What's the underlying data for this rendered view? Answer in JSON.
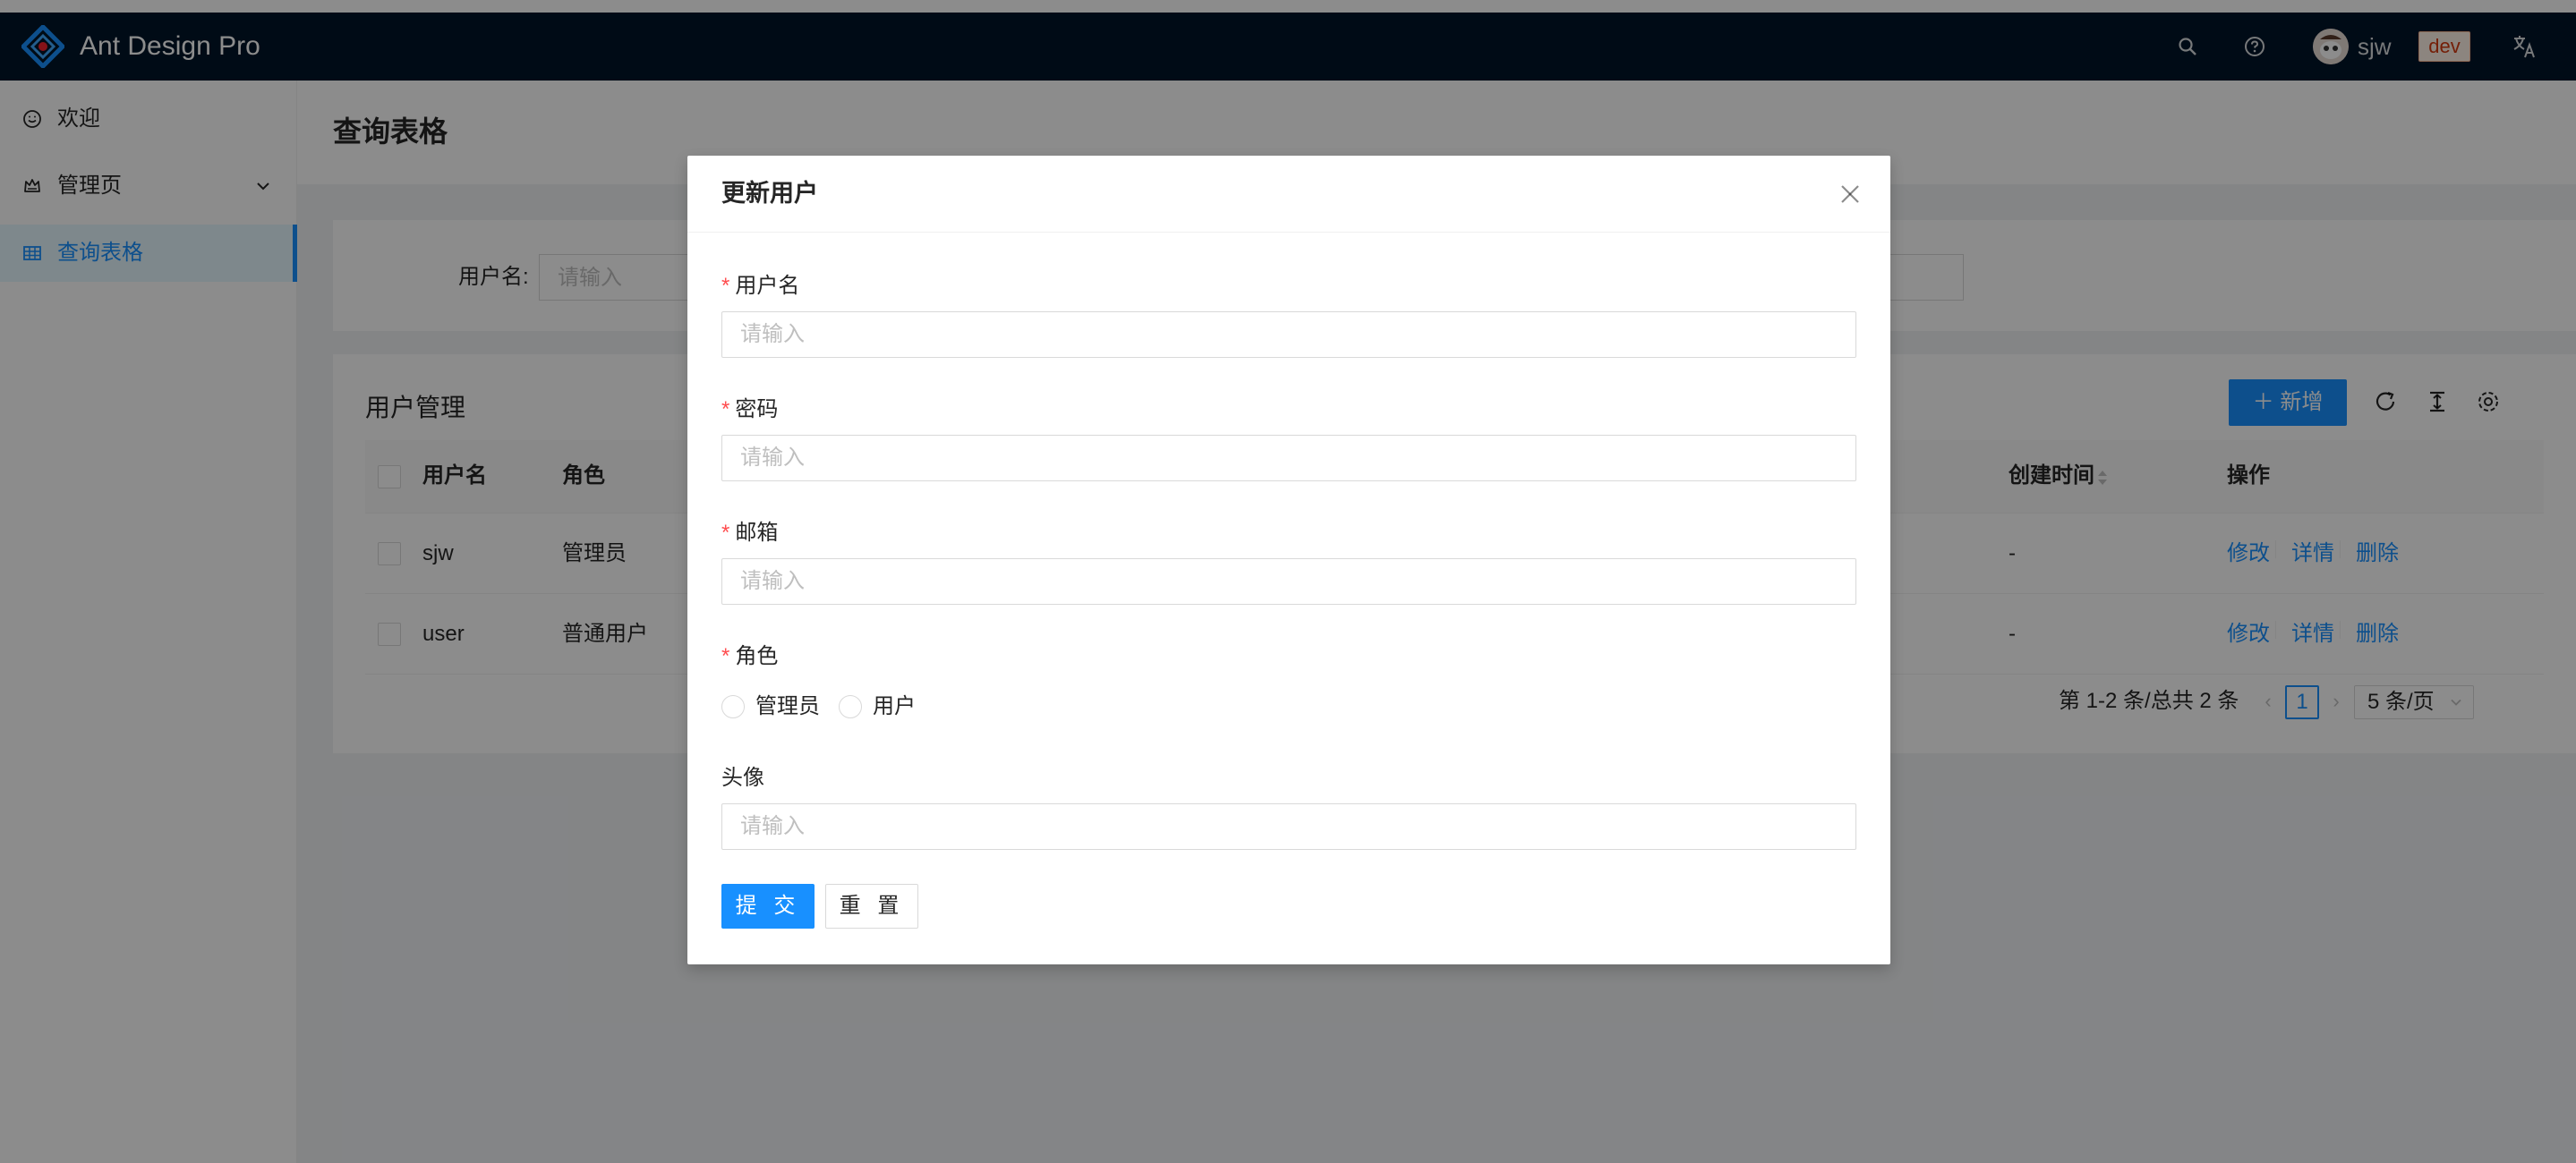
{
  "app": {
    "title": "Ant Design Pro"
  },
  "header": {
    "user_name": "sjw",
    "env_tag": "dev",
    "icons": [
      "search-icon",
      "question-icon",
      "translate-icon"
    ]
  },
  "sidebar": {
    "items": [
      {
        "label": "欢迎",
        "icon": "smile-icon"
      },
      {
        "label": "管理页",
        "icon": "crown-icon"
      },
      {
        "label": "查询表格",
        "icon": "table-icon",
        "selected": true
      }
    ]
  },
  "page": {
    "title": "查询表格",
    "search": {
      "label": "用户名:",
      "placeholder": "请输入"
    }
  },
  "table": {
    "title": "用户管理",
    "new_button": "新增",
    "columns": [
      "用户名",
      "角色",
      "创建时间",
      "操作"
    ],
    "rows": [
      {
        "username": "sjw",
        "role": "管理员",
        "created": "-"
      },
      {
        "username": "user",
        "role": "普通用户",
        "created": "-"
      }
    ],
    "actions": {
      "edit": "修改",
      "detail": "详情",
      "delete": "删除"
    },
    "pagination": {
      "summary": "第 1-2 条/总共 2 条",
      "current_page": "1",
      "page_size": "5 条/页"
    }
  },
  "modal": {
    "title": "更新用户",
    "fields": [
      {
        "label": "用户名",
        "required": "*",
        "placeholder": "请输入"
      },
      {
        "label": "密码",
        "required": "*",
        "placeholder": "请输入"
      },
      {
        "label": "邮箱",
        "required": "*",
        "placeholder": "请输入"
      },
      {
        "label": "角色",
        "required": "*"
      },
      {
        "label": "头像",
        "placeholder": "请输入"
      }
    ],
    "role_options": [
      "管理员",
      "用户"
    ],
    "submit_label": "提 交",
    "reset_label": "重 置"
  },
  "colors": {
    "primary": "#1890ff",
    "header_bg": "#001529",
    "required": "#ff4d4f",
    "mask": "rgba(0,0,0,0.45)"
  }
}
